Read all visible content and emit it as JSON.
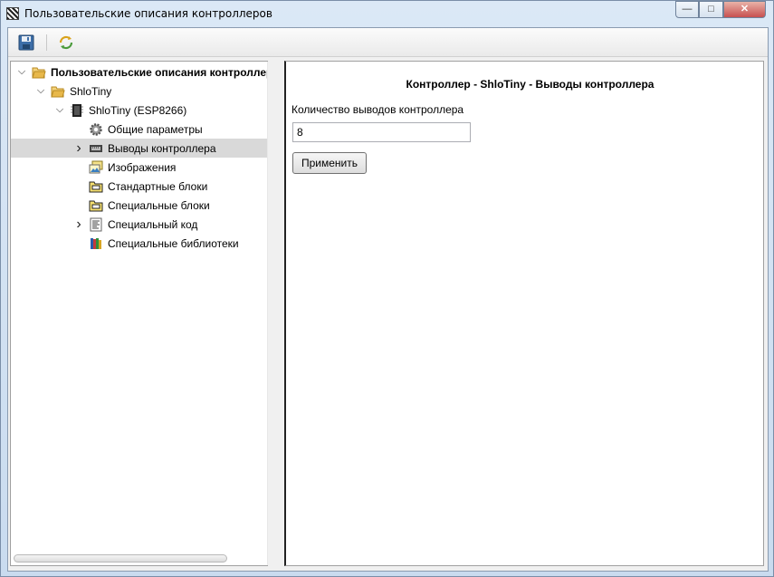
{
  "window": {
    "title": "Пользовательские описания контроллеров",
    "minimize_glyph": "—",
    "maximize_glyph": "□",
    "close_glyph": "✕"
  },
  "toolbar": {
    "save_icon": "save-icon",
    "refresh_icon": "refresh-icon"
  },
  "tree": {
    "items": [
      {
        "label": "Пользовательские описания контроллеров",
        "chevron": "⌵",
        "icon": "folder-open-icon",
        "bold": true,
        "selected": false
      },
      {
        "label": "ShloTiny",
        "chevron": "⌵",
        "icon": "folder-open-icon",
        "bold": false,
        "selected": false
      },
      {
        "label": "ShloTiny (ESP8266)",
        "chevron": "⌵",
        "icon": "chip-icon",
        "bold": false,
        "selected": false
      },
      {
        "label": "Общие параметры",
        "chevron": "",
        "icon": "gear-icon",
        "bold": false,
        "selected": false
      },
      {
        "label": "Выводы контроллера",
        "chevron": "›",
        "icon": "pins-icon",
        "bold": false,
        "selected": true
      },
      {
        "label": "Изображения",
        "chevron": "",
        "icon": "images-icon",
        "bold": false,
        "selected": false
      },
      {
        "label": "Стандартные блоки",
        "chevron": "",
        "icon": "blocks-icon",
        "bold": false,
        "selected": false
      },
      {
        "label": "Специальные блоки",
        "chevron": "",
        "icon": "blocks-icon",
        "bold": false,
        "selected": false
      },
      {
        "label": "Специальный код",
        "chevron": "›",
        "icon": "code-icon",
        "bold": false,
        "selected": false
      },
      {
        "label": "Специальные библиотеки",
        "chevron": "",
        "icon": "library-icon",
        "bold": false,
        "selected": false
      }
    ]
  },
  "panel": {
    "title": "Контроллер - ShloTiny - Выводы контроллера",
    "pins_count_label": "Количество выводов контроллера",
    "pins_count_value": "8",
    "apply_label": "Применить"
  },
  "colors": {
    "selection": "#d9d9d9",
    "folder": "#e8b84a",
    "window_frame": "#c9dbef"
  }
}
